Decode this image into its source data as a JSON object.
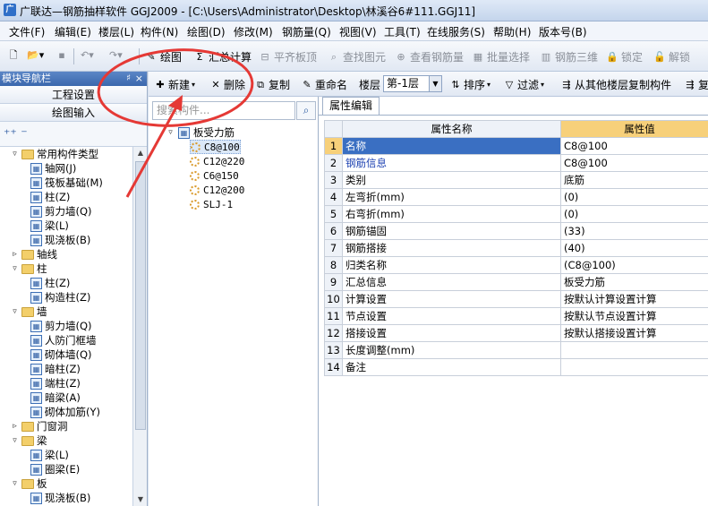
{
  "window": {
    "title": "广联达—钢筋抽样软件 GGJ2009 - [C:\\Users\\Administrator\\Desktop\\林溪谷6#111.GGJ11]"
  },
  "menu": [
    "文件(F)",
    "编辑(E)",
    "楼层(L)",
    "构件(N)",
    "绘图(D)",
    "修改(M)",
    "钢筋量(Q)",
    "视图(V)",
    "工具(T)",
    "在线服务(S)",
    "帮助(H)",
    "版本号(B)"
  ],
  "toolbar1": {
    "draw": "绘图",
    "sum": "汇总计算",
    "flat": "平齐板顶",
    "find": "查找图元",
    "view_rebar": "查看钢筋量",
    "batch": "批量选择",
    "rebar3d": "钢筋三维",
    "lock": "锁定",
    "unlock": "解锁"
  },
  "nav": {
    "title": "模块导航栏",
    "btn_project": "工程设置",
    "btn_draw": "绘图输入",
    "tree": [
      {
        "label": "常用构件类型",
        "level": 0,
        "type": "folder",
        "exp": "▿"
      },
      {
        "label": "轴网(J)",
        "level": 1,
        "type": "cmp"
      },
      {
        "label": "筏板基础(M)",
        "level": 1,
        "type": "cmp"
      },
      {
        "label": "柱(Z)",
        "level": 1,
        "type": "cmp"
      },
      {
        "label": "剪力墙(Q)",
        "level": 1,
        "type": "cmp"
      },
      {
        "label": "梁(L)",
        "level": 1,
        "type": "cmp"
      },
      {
        "label": "现浇板(B)",
        "level": 1,
        "type": "cmp"
      },
      {
        "label": "轴线",
        "level": 0,
        "type": "folder",
        "exp": "▹"
      },
      {
        "label": "柱",
        "level": 0,
        "type": "folder",
        "exp": "▿"
      },
      {
        "label": "柱(Z)",
        "level": 1,
        "type": "cmp"
      },
      {
        "label": "构造柱(Z)",
        "level": 1,
        "type": "cmp"
      },
      {
        "label": "墙",
        "level": 0,
        "type": "folder",
        "exp": "▿"
      },
      {
        "label": "剪力墙(Q)",
        "level": 1,
        "type": "cmp"
      },
      {
        "label": "人防门框墙",
        "level": 1,
        "type": "cmp"
      },
      {
        "label": "砌体墙(Q)",
        "level": 1,
        "type": "cmp"
      },
      {
        "label": "暗柱(Z)",
        "level": 1,
        "type": "cmp"
      },
      {
        "label": "端柱(Z)",
        "level": 1,
        "type": "cmp"
      },
      {
        "label": "暗梁(A)",
        "level": 1,
        "type": "cmp"
      },
      {
        "label": "砌体加筋(Y)",
        "level": 1,
        "type": "cmp"
      },
      {
        "label": "门窗洞",
        "level": 0,
        "type": "folder",
        "exp": "▹"
      },
      {
        "label": "梁",
        "level": 0,
        "type": "folder",
        "exp": "▿"
      },
      {
        "label": "梁(L)",
        "level": 1,
        "type": "cmp"
      },
      {
        "label": "圈梁(E)",
        "level": 1,
        "type": "cmp"
      },
      {
        "label": "板",
        "level": 0,
        "type": "folder",
        "exp": "▿"
      },
      {
        "label": "现浇板(B)",
        "level": 1,
        "type": "cmp"
      }
    ]
  },
  "toolbar2": {
    "new": "新建",
    "delete": "删除",
    "copy": "复制",
    "rename": "重命名",
    "floor_label": "楼层",
    "floor_value": "第-1层",
    "sort": "排序",
    "filter": "过滤",
    "copy_from": "从其他楼层复制构件",
    "more": "复"
  },
  "search": {
    "placeholder": "搜索构件..."
  },
  "component_tree": {
    "root": "板受力筋",
    "items": [
      "C8@100",
      "C12@220",
      "C6@150",
      "C12@200",
      "SLJ-1"
    ]
  },
  "props": {
    "tab": "属性编辑",
    "col_name": "属性名称",
    "col_value": "属性值",
    "rows": [
      {
        "no": "1",
        "name": "名称",
        "value": "C8@100",
        "blue": false
      },
      {
        "no": "2",
        "name": "钢筋信息",
        "value": "C8@100",
        "blue": true
      },
      {
        "no": "3",
        "name": "类别",
        "value": "底筋",
        "blue": false
      },
      {
        "no": "4",
        "name": "左弯折(mm)",
        "value": "(0)",
        "blue": false
      },
      {
        "no": "5",
        "name": "右弯折(mm)",
        "value": "(0)",
        "blue": false
      },
      {
        "no": "6",
        "name": "钢筋锚固",
        "value": "(33)",
        "blue": false
      },
      {
        "no": "7",
        "name": "钢筋搭接",
        "value": "(40)",
        "blue": false
      },
      {
        "no": "8",
        "name": "归类名称",
        "value": "(C8@100)",
        "blue": false
      },
      {
        "no": "9",
        "name": "汇总信息",
        "value": "板受力筋",
        "blue": false
      },
      {
        "no": "10",
        "name": "计算设置",
        "value": "按默认计算设置计算",
        "blue": false
      },
      {
        "no": "11",
        "name": "节点设置",
        "value": "按默认节点设置计算",
        "blue": false
      },
      {
        "no": "12",
        "name": "搭接设置",
        "value": "按默认搭接设置计算",
        "blue": false
      },
      {
        "no": "13",
        "name": "长度调整(mm)",
        "value": "",
        "blue": false
      },
      {
        "no": "14",
        "name": "备注",
        "value": "",
        "blue": false
      }
    ]
  },
  "colors": {
    "accent": "#3a6fc2",
    "highlight": "#f7d07a",
    "annotation": "#e53935"
  }
}
